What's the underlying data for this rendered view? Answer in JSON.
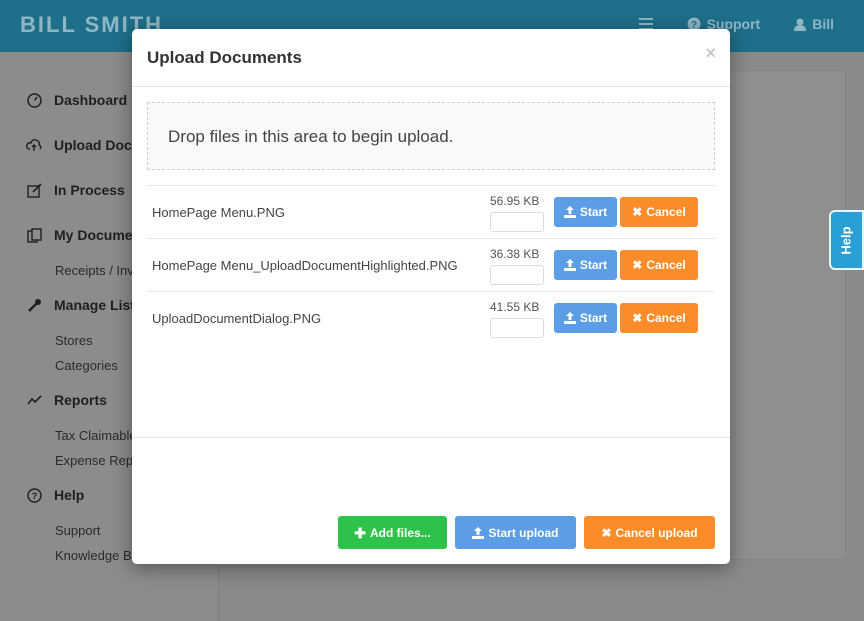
{
  "header": {
    "brand": "BILL SMITH",
    "support_label": "Support",
    "user_label": "Bill"
  },
  "sidebar": {
    "items": [
      {
        "label": "Dashboard",
        "icon": "dashboard-icon"
      },
      {
        "label": "Upload Docu",
        "icon": "upload-cloud-icon"
      },
      {
        "label": "In Process",
        "icon": "edit-icon"
      },
      {
        "label": "My Documen",
        "icon": "copy-icon"
      },
      {
        "label": "Manage Lists",
        "icon": "wrench-icon"
      },
      {
        "label": "Reports",
        "icon": "chart-line-icon"
      },
      {
        "label": "Help",
        "icon": "question-circle-icon"
      }
    ],
    "subitems": {
      "receipts": "Receipts / Inv",
      "stores": "Stores",
      "categories": "Categories",
      "tax": "Tax Claimable",
      "expense": "Expense Repo",
      "support": "Support",
      "knowledge": "Knowledge B"
    }
  },
  "help_tab": "Help",
  "modal": {
    "title": "Upload Documents",
    "close": "×",
    "dropzone_text": "Drop files in this area to begin upload.",
    "start_label": "Start",
    "cancel_label": "Cancel",
    "files": [
      {
        "name": "HomePage Menu.PNG",
        "size": "56.95 KB",
        "progress": 0
      },
      {
        "name": "HomePage Menu_UploadDocumentHighlighted.PNG",
        "size": "36.38 KB",
        "progress": 0
      },
      {
        "name": "UploadDocumentDialog.PNG",
        "size": "41.55 KB",
        "progress": 0
      }
    ],
    "footer": {
      "add_files": "Add files...",
      "start_upload": "Start upload",
      "cancel_upload": "Cancel upload"
    }
  },
  "colors": {
    "topbar": "#1e6f8a",
    "start": "#5b9ee6",
    "cancel": "#fa8c2a",
    "add": "#2ec24a",
    "help_tab": "#2a9fd6"
  }
}
